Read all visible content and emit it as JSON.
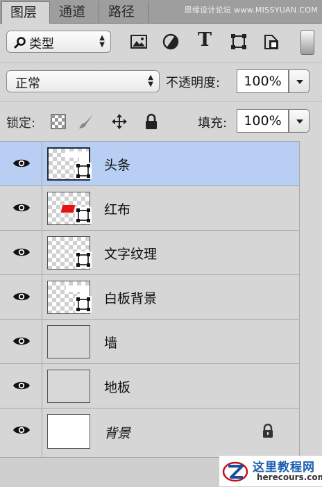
{
  "tabs": [
    {
      "label": "图层",
      "active": true
    },
    {
      "label": "通道",
      "active": false
    },
    {
      "label": "路径",
      "active": false
    }
  ],
  "watermark_top": "思缘设计论坛 www.MISSYUAN.COM",
  "filter": {
    "kind_label": "类型",
    "buttons": [
      "image-filter-icon",
      "adjustment-filter-icon",
      "type-filter-icon",
      "shape-filter-icon",
      "smart-object-filter-icon"
    ],
    "type_icon_glyph": "T"
  },
  "blend": {
    "mode": "正常",
    "opacity_label": "不透明度:",
    "opacity_value": "100%"
  },
  "lock": {
    "label": "锁定:",
    "fill_label": "填充:",
    "fill_value": "100%"
  },
  "layers": [
    {
      "name": "头条",
      "thumb": "checker-white-corner",
      "selected": true
    },
    {
      "name": "红布",
      "thumb": "checker-red",
      "selected": false
    },
    {
      "name": "文字纹理",
      "thumb": "checker",
      "selected": false
    },
    {
      "name": "白板背景",
      "thumb": "checker-white-corner",
      "selected": false
    },
    {
      "name": "墙",
      "thumb": "plain",
      "selected": false
    },
    {
      "name": "地板",
      "thumb": "plain",
      "selected": false
    },
    {
      "name": "背景",
      "thumb": "white",
      "selected": false,
      "locked": true
    }
  ],
  "colors": {
    "selection": "#b8cff3",
    "panel": "#d6d6d6",
    "red_fabric": "#e81010"
  },
  "watermark_bottom": {
    "title": "这里教程网",
    "url": "herecours.com"
  }
}
